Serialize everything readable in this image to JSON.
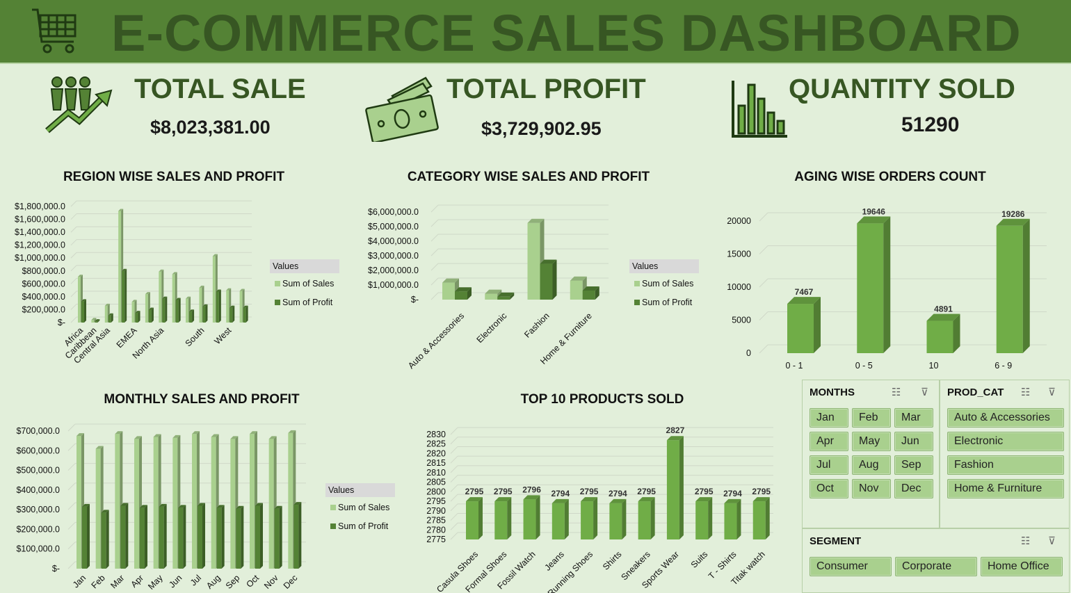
{
  "banner": {
    "title": "E-COMMERCE SALES DASHBOARD"
  },
  "kpis": {
    "total_sale": {
      "label": "TOTAL SALE",
      "value": "$8,023,381.00"
    },
    "total_profit": {
      "label": "TOTAL PROFIT",
      "value": "$3,729,902.95"
    },
    "quantity_sold": {
      "label": "QUANTITY SOLD",
      "value": "51290"
    }
  },
  "colors": {
    "banner": "#548235",
    "sales": "#a9d08e",
    "profit": "#548235",
    "bar": "#70ad47",
    "background": "#e2efda"
  },
  "chart_data": [
    {
      "id": "region",
      "type": "bar",
      "title": "REGION WISE SALES AND PROFIT",
      "categories": [
        "Africa",
        "Caribbean",
        "Central Asia",
        "",
        "EMEA",
        "",
        "North Asia",
        "",
        "South",
        "",
        "West"
      ],
      "series": [
        {
          "name": "Sum of Sales",
          "values": [
            710000,
            40000,
            260000,
            1730000,
            320000,
            440000,
            790000,
            750000,
            370000,
            540000,
            1030000,
            500000,
            490000
          ]
        },
        {
          "name": "Sum of Profit",
          "values": [
            330000,
            20000,
            110000,
            800000,
            150000,
            200000,
            370000,
            350000,
            170000,
            250000,
            480000,
            230000,
            230000
          ]
        }
      ],
      "bar_count": 13,
      "label_slots": [
        0,
        1,
        2,
        4,
        6,
        9,
        11
      ],
      "labels": [
        "Africa",
        "Caribbean",
        "Central Asia",
        "EMEA",
        "North Asia",
        "South",
        "West"
      ],
      "y_ticks": [
        "$1,800,000.0",
        "$1,600,000.0",
        "$1,400,000.0",
        "$1,200,000.0",
        "$1,000,000.0",
        "$800,000.0",
        "$600,000.0",
        "$400,000.0",
        "$200,000.0",
        "$-"
      ],
      "ylim": [
        0,
        1800000
      ],
      "legend": {
        "title": "Values",
        "items": [
          "Sum of Sales",
          "Sum of Profit"
        ],
        "position": "right"
      }
    },
    {
      "id": "category",
      "type": "bar",
      "title": "CATEGORY WISE SALES AND PROFIT",
      "categories": [
        "Auto & Accessories",
        "Electronic",
        "Fashion",
        "Home & Furniture"
      ],
      "series": [
        {
          "name": "Sum of Sales",
          "values": [
            1160000,
            400000,
            5250000,
            1300000
          ]
        },
        {
          "name": "Sum of Profit",
          "values": [
            560000,
            200000,
            2450000,
            620000
          ]
        }
      ],
      "y_ticks": [
        "$6,000,000.0",
        "$5,000,000.0",
        "$4,000,000.0",
        "$3,000,000.0",
        "$2,000,000.0",
        "$1,000,000.0",
        "$-"
      ],
      "ylim": [
        0,
        6000000
      ],
      "legend": {
        "title": "Values",
        "items": [
          "Sum of Sales",
          "Sum of Profit"
        ],
        "position": "right"
      }
    },
    {
      "id": "aging",
      "type": "bar",
      "title": "AGING WISE ORDERS COUNT",
      "categories": [
        "0 - 1",
        "0 - 5",
        "10",
        "6 - 9"
      ],
      "values": [
        7467,
        19646,
        4891,
        19286
      ],
      "y_ticks": [
        "20000",
        "15000",
        "10000",
        "5000",
        "0"
      ],
      "ylim": [
        0,
        20000
      ]
    },
    {
      "id": "monthly",
      "type": "bar",
      "title": "MONTHLY SALES AND PROFIT",
      "categories": [
        "Jan",
        "Feb",
        "Mar",
        "Apr",
        "May",
        "Jun",
        "Jul",
        "Aug",
        "Sep",
        "Oct",
        "Nov",
        "Dec"
      ],
      "series": [
        {
          "name": "Sum of Sales",
          "values": [
            675000,
            610000,
            685000,
            660000,
            670000,
            665000,
            685000,
            670000,
            660000,
            685000,
            660000,
            690000
          ]
        },
        {
          "name": "Sum of Profit",
          "values": [
            315000,
            285000,
            320000,
            310000,
            315000,
            310000,
            320000,
            310000,
            305000,
            320000,
            305000,
            325000
          ]
        }
      ],
      "y_ticks": [
        "$700,000.0",
        "$600,000.0",
        "$500,000.0",
        "$400,000.0",
        "$300,000.0",
        "$200,000.0",
        "$100,000.0",
        "$-"
      ],
      "ylim": [
        0,
        700000
      ],
      "legend": {
        "title": "Values",
        "items": [
          "Sum of Sales",
          "Sum of Profit"
        ],
        "position": "right"
      }
    },
    {
      "id": "top10",
      "type": "bar",
      "title": "TOP 10 PRODUCTS SOLD",
      "categories": [
        "Casula Shoes",
        "Formal Shoes",
        "Fossil Watch",
        "Jeans",
        "Running Shoes",
        "Shirts",
        "Sneakers",
        "Sports Wear",
        "Suits",
        "T - Shirts",
        "Titak watch"
      ],
      "values": [
        2795,
        2795,
        2796,
        2794,
        2795,
        2794,
        2795,
        2827,
        2795,
        2794,
        2795
      ],
      "y_ticks": [
        "2830",
        "2825",
        "2820",
        "2815",
        "2810",
        "2805",
        "2800",
        "2795",
        "2790",
        "2785",
        "2780",
        "2775"
      ],
      "ylim": [
        2775,
        2830
      ]
    }
  ],
  "slicers": {
    "months": {
      "title": "MONTHS",
      "items": [
        "Jan",
        "Feb",
        "Mar",
        "Apr",
        "May",
        "Jun",
        "Jul",
        "Aug",
        "Sep",
        "Oct",
        "Nov",
        "Dec"
      ]
    },
    "prod_cat": {
      "title": "PROD_CAT",
      "items": [
        "Auto & Accessories",
        "Electronic",
        "Fashion",
        "Home & Furniture"
      ]
    },
    "segment": {
      "title": "SEGMENT",
      "items": [
        "Consumer",
        "Corporate",
        "Home Office"
      ]
    }
  }
}
